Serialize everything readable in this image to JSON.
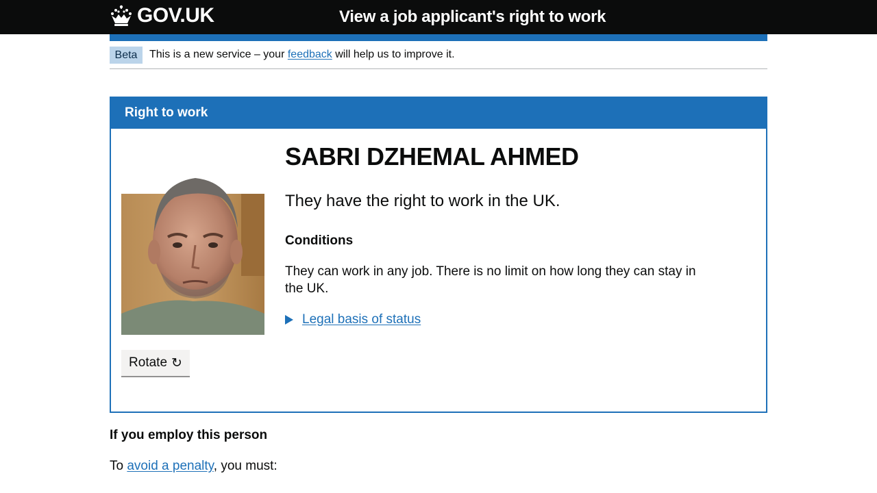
{
  "header": {
    "logo_text": "GOV.UK",
    "service_name": "View a job applicant's right to work",
    "crown_icon": "crown-icon"
  },
  "phase_banner": {
    "tag": "Beta",
    "text_before": "This is a new service – your ",
    "link": "feedback",
    "text_after": " will help us to improve it."
  },
  "panel": {
    "title": "Right to work",
    "person_name": "SABRI DZHEMAL AHMED",
    "status": "They have the right to work in the UK.",
    "conditions_heading": "Conditions",
    "conditions_text": "They can work in any job. There is no limit on how long they can stay in the UK.",
    "legal_basis_link": "Legal basis of status",
    "rotate_label": "Rotate",
    "rotate_glyph": "↻",
    "photo_icon": "applicant-photo"
  },
  "employ": {
    "heading": "If you employ this person",
    "text_before": "To ",
    "link": "avoid a penalty",
    "text_after": ", you must:"
  },
  "colors": {
    "header_bg": "#0b0c0c",
    "brand_blue": "#1d70b8",
    "beta_tag_bg": "#bbd4ea",
    "button_bg": "#f3f2f1"
  }
}
